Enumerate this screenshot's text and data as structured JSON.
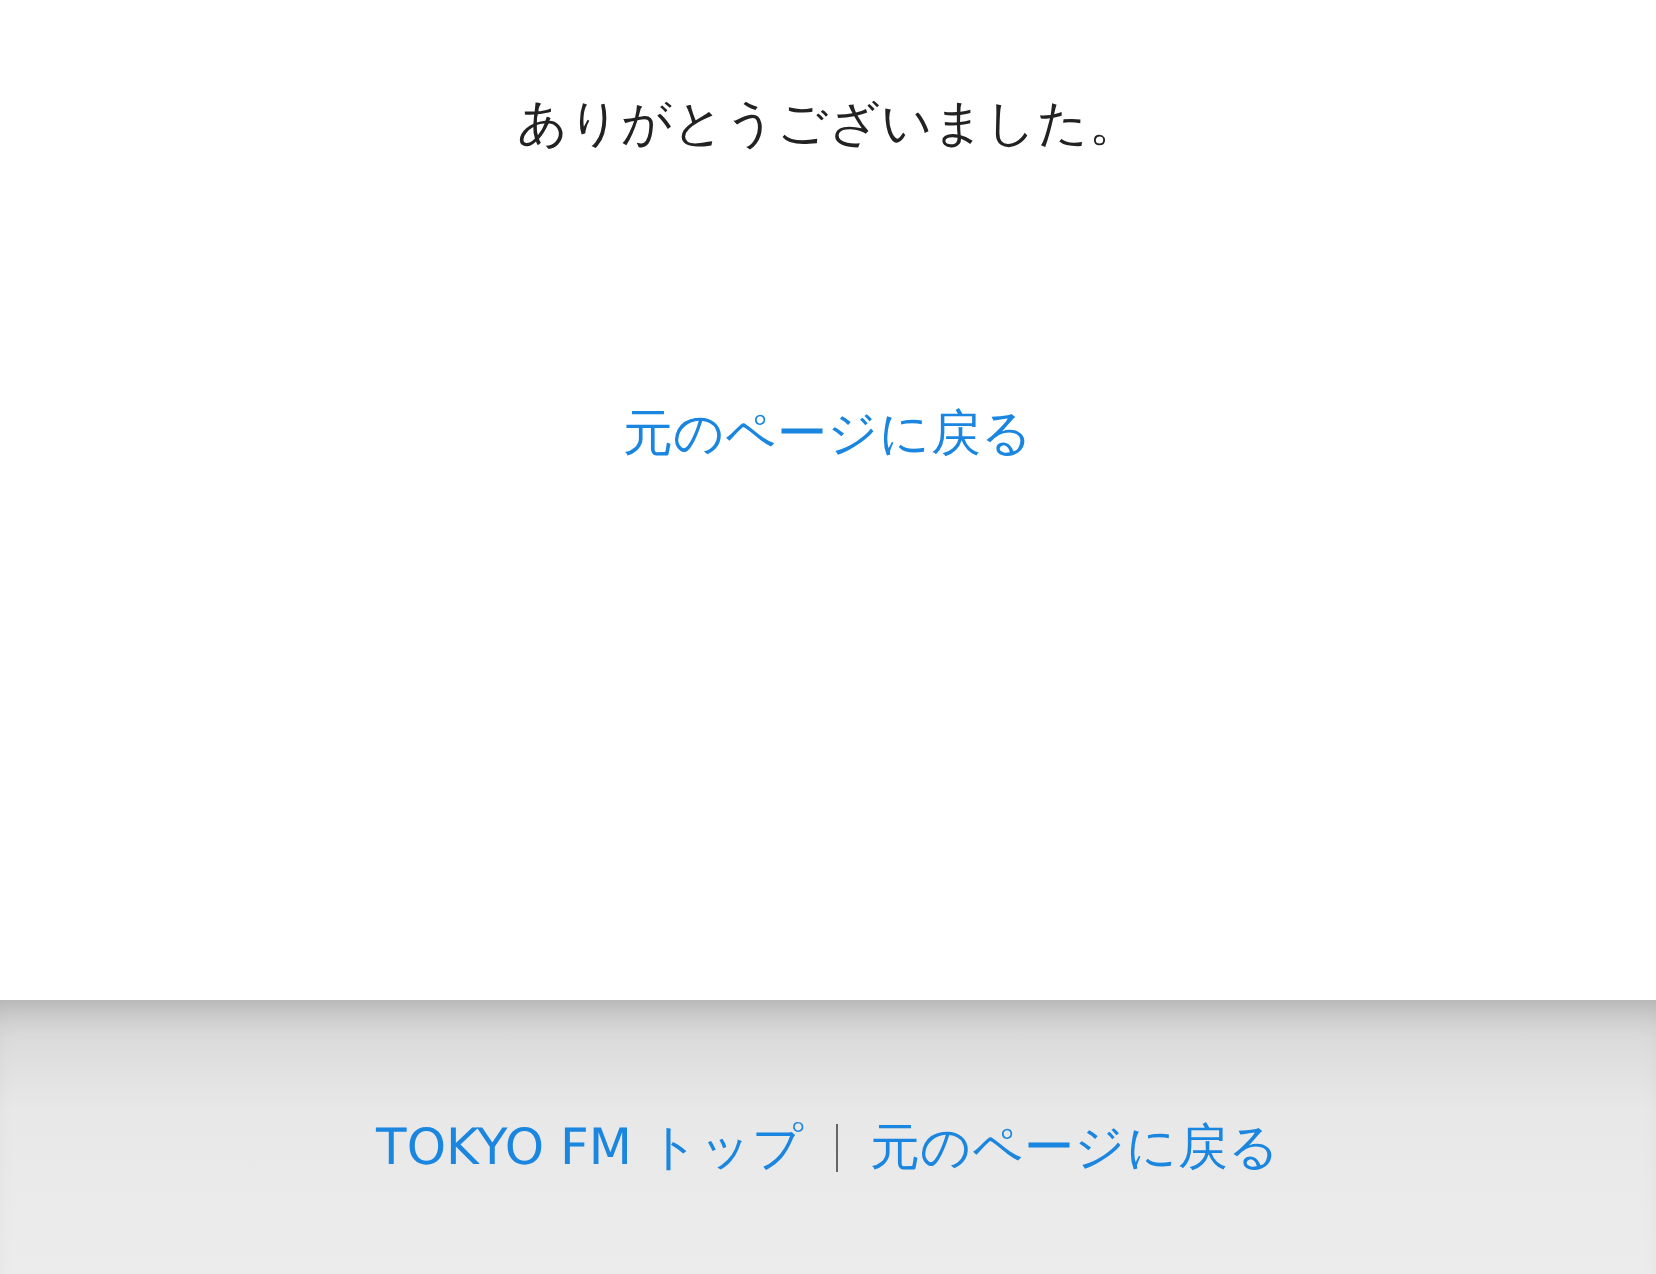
{
  "message": "ありがとうございました。",
  "back_link": "元のページに戻る",
  "footer": {
    "links": [
      {
        "label": "TOKYO FM トップ"
      },
      {
        "label": "元のページに戻る"
      }
    ]
  }
}
